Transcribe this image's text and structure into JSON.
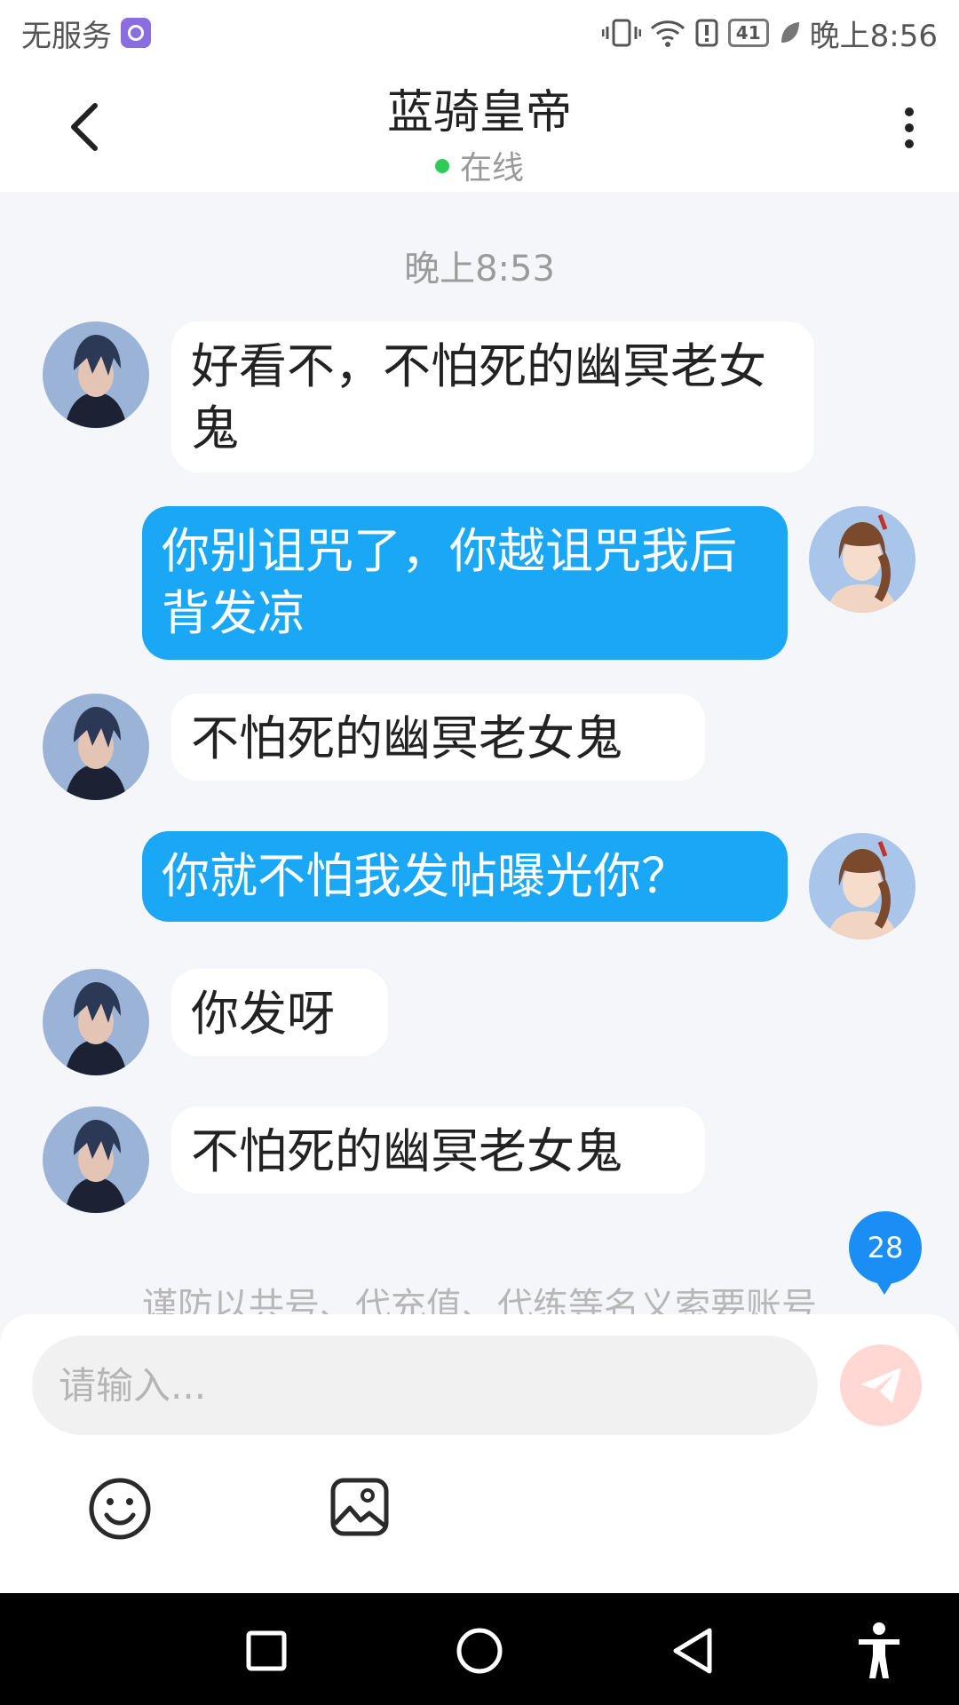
{
  "status_bar": {
    "carrier": "无服务",
    "battery": "41",
    "time": "晚上8:56"
  },
  "header": {
    "title": "蓝骑皇帝",
    "status": "在线"
  },
  "chat": {
    "timestamp": "晚上8:53",
    "messages": [
      {
        "side": "in",
        "text": "好看不，不怕死的幽冥老女鬼"
      },
      {
        "side": "out",
        "text": "你别诅咒了，你越诅咒我后背发凉"
      },
      {
        "side": "in",
        "text": "不怕死的幽冥老女鬼"
      },
      {
        "side": "out",
        "text": "你就不怕我发帖曝光你？"
      },
      {
        "side": "in",
        "text": "你发呀"
      },
      {
        "side": "in",
        "text": "不怕死的幽冥老女鬼"
      }
    ],
    "notice": "谨防以共号、代充值、代练等名义索要账号",
    "unread_count": "28"
  },
  "input": {
    "placeholder": "请输入..."
  },
  "colors": {
    "accent": "#1aa7f6",
    "online": "#2ecc55",
    "send_disabled": "#ffd7d3"
  },
  "icons": [
    "back-arrow-icon",
    "more-vertical-icon",
    "send-icon",
    "emoji-icon",
    "image-icon",
    "square-icon",
    "circle-icon",
    "triangle-back-icon",
    "accessibility-icon"
  ]
}
